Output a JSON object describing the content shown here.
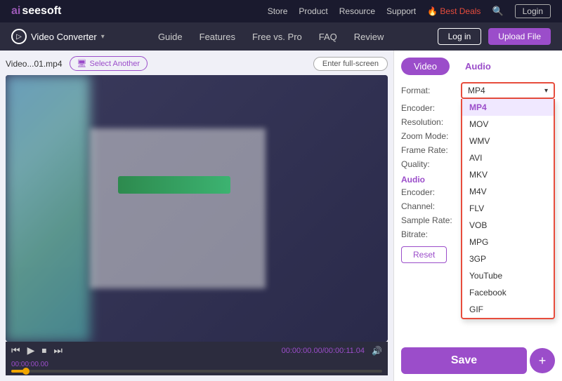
{
  "topNav": {
    "logo_ai": "ai",
    "logo_text": "seesoft",
    "links": [
      "Store",
      "Product",
      "Resource",
      "Support",
      "Best Deals"
    ],
    "login_label": "Login"
  },
  "secondNav": {
    "app_title": "Video Converter",
    "links": [
      "Guide",
      "Features",
      "Free vs. Pro",
      "FAQ",
      "Review"
    ],
    "login_label": "Log in",
    "upload_label": "Upload File"
  },
  "fileBar": {
    "file_name": "Video...01.mp4",
    "select_another": "Select Another",
    "fullscreen": "Enter full-screen"
  },
  "videoControls": {
    "time_display": "00:00:00.00/00:00:11.04",
    "time_label": "00:00:00.00"
  },
  "rightPanel": {
    "tab_video": "Video",
    "tab_audio": "Audio",
    "format_label": "Format:",
    "encoder_label": "Encoder:",
    "resolution_label": "Resolution:",
    "zoom_label": "Zoom Mode:",
    "frame_rate_label": "Frame Rate:",
    "quality_label": "Quality:",
    "audio_section": "Audio",
    "audio_encoder_label": "Encoder:",
    "channel_label": "Channel:",
    "sample_rate_label": "Sample Rate:",
    "bitrate_label": "Bitrate:",
    "reset_label": "Reset",
    "save_label": "Save",
    "format_selected": "MP4",
    "format_options": [
      "MP4",
      "MOV",
      "WMV",
      "AVI",
      "MKV",
      "M4V",
      "FLV",
      "VOB",
      "MPG",
      "3GP",
      "YouTube",
      "Facebook",
      "GIF"
    ]
  }
}
